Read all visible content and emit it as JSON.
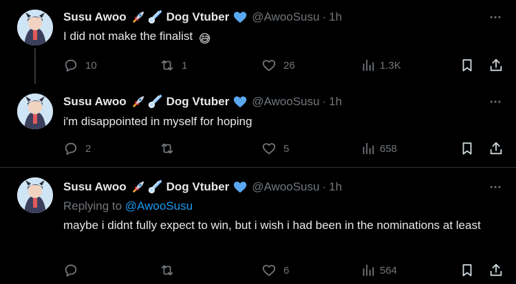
{
  "tweets": [
    {
      "name": "Susu Awoo",
      "name_suffix": "Dog Vtuber",
      "handle": "@AwooSusu",
      "separator": "·",
      "time": "1h",
      "text": "I did not make the finalist",
      "text_emoji": "😅",
      "replies": "10",
      "reposts": "1",
      "likes": "26",
      "views": "1.3K"
    },
    {
      "name": "Susu Awoo",
      "name_suffix": "Dog Vtuber",
      "handle": "@AwooSusu",
      "separator": "·",
      "time": "1h",
      "text": "i'm disappointed in myself for hoping",
      "replies": "2",
      "reposts": "",
      "likes": "5",
      "views": "658"
    },
    {
      "name": "Susu Awoo",
      "name_suffix": "Dog Vtuber",
      "handle": "@AwooSusu",
      "separator": "·",
      "time": "1h",
      "replying_label": "Replying to",
      "replying_to": "@AwooSusu",
      "text": "maybe i didnt fully expect to win, but i wish i had been in the nominations at least",
      "replies": "",
      "reposts": "",
      "likes": "6",
      "views": "564"
    }
  ],
  "icons": {
    "reply": "reply-icon",
    "repost": "repost-icon",
    "like": "heart-icon",
    "views": "views-icon",
    "bookmark": "bookmark-icon",
    "share": "share-icon",
    "more": "more-icon",
    "verified": "verified-icon",
    "rocket": "rocket-emoji-icon",
    "comet": "comet-emoji-icon"
  },
  "colors": {
    "background": "#000000",
    "text": "#e7e9ea",
    "muted": "#71767b",
    "accent": "#1d9bf0",
    "verified": "#5aa8f0"
  }
}
